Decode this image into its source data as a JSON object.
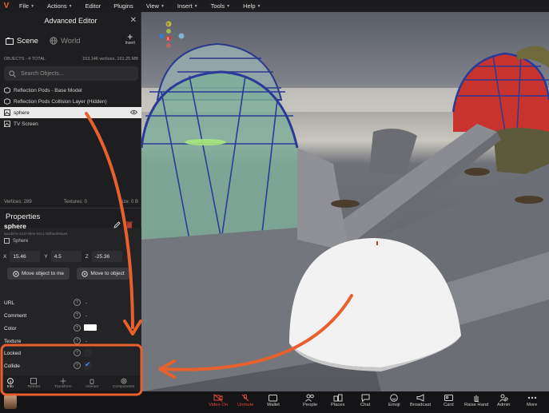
{
  "menubar": {
    "logo": "V",
    "items": [
      {
        "label": "File"
      },
      {
        "label": "Actions"
      },
      {
        "label": "Editor"
      },
      {
        "label": "Plugins"
      },
      {
        "label": "View"
      },
      {
        "label": "Insert"
      },
      {
        "label": "Tools"
      },
      {
        "label": "Help"
      }
    ]
  },
  "panel": {
    "title": "Advanced Editor",
    "close": "✕",
    "tabs": [
      {
        "label": "Scene"
      },
      {
        "label": "World"
      }
    ],
    "insert_label": "Insert",
    "objects_title": "OBJECTS - 4 TOTAL",
    "objects_stats": "153,146 vertices, 161.25 MB",
    "search_placeholder": "Search Objects...",
    "objects": [
      {
        "label": "Reflection Pods - Base Model"
      },
      {
        "label": "Reflection Pods Collision Layer (Hidden)"
      },
      {
        "label": "sphere"
      },
      {
        "label": "TV Screen"
      }
    ],
    "stats": {
      "vertices": "Vertices: 289",
      "textures": "Textures: 0",
      "size": "Size: 0 B"
    },
    "properties": {
      "title": "Properties",
      "name": "sphere",
      "id": "aa1d97a-224f-4b0e-b5c1-0bffaed09aa4",
      "type": "Sphere",
      "x_label": "X",
      "x": "15.46",
      "y_label": "Y",
      "y": "4.5",
      "z_label": "Z",
      "z": "-25.36",
      "move_to_me": "Move object to me",
      "move_to_object": "Move to object",
      "rows": {
        "url": {
          "label": "URL",
          "value": "-"
        },
        "comment": {
          "label": "Comment",
          "value": "-"
        },
        "color": {
          "label": "Color",
          "value": "#ffffff"
        },
        "texture": {
          "label": "Texture",
          "value": "-"
        },
        "locked": {
          "label": "Locked"
        },
        "collide": {
          "label": "Collide"
        }
      }
    },
    "bottom_tabs": [
      {
        "label": "Info"
      },
      {
        "label": "Render"
      },
      {
        "label": "Transform"
      },
      {
        "label": "Interact"
      },
      {
        "label": "Components"
      }
    ]
  },
  "toolbar": {
    "items": [
      {
        "label": "Video On"
      },
      {
        "label": "Unmute"
      },
      {
        "label": "Wallet"
      },
      {
        "label": "People"
      },
      {
        "label": "Places"
      },
      {
        "label": "Chat"
      },
      {
        "label": "Emoji"
      },
      {
        "label": "Broadcast"
      },
      {
        "label": "Card"
      },
      {
        "label": "Raise Hand"
      },
      {
        "label": "Admin"
      },
      {
        "label": "More"
      }
    ]
  },
  "gizmo": {
    "y": "Y",
    "x": "X"
  },
  "colors": {
    "accent": "#e8612c",
    "danger": "#e2463b",
    "check": "#3e8cff",
    "panel": "#1e1e20"
  }
}
